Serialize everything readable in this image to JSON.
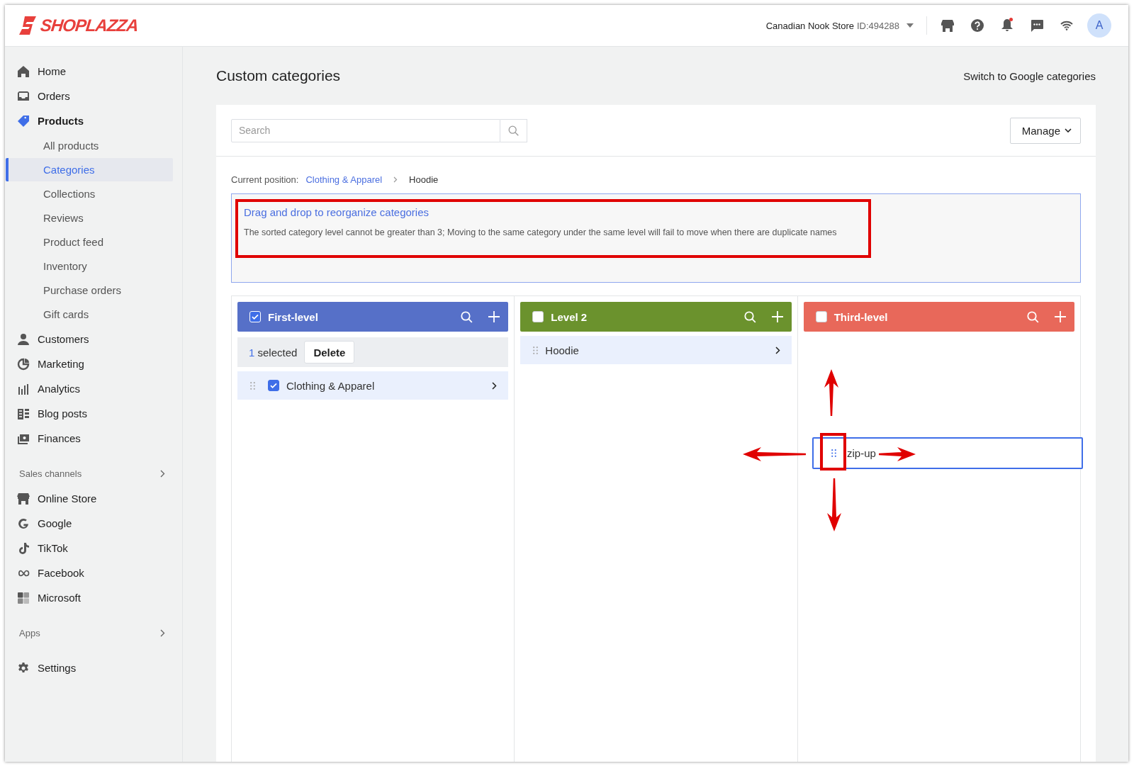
{
  "logo": {
    "text": "SHOPLAZZA"
  },
  "header": {
    "store": "Canadian Nook Store",
    "store_id": "ID:494288",
    "avatar": "A",
    "notification_dot": true
  },
  "sidebar": {
    "groups": [
      {
        "items": [
          {
            "label": "Home",
            "selected": false
          },
          {
            "label": "Orders",
            "selected": false
          },
          {
            "label": "Products",
            "selected": true,
            "children": [
              {
                "label": "All products",
                "selected": false
              },
              {
                "label": "Categories",
                "selected": true
              },
              {
                "label": "Collections",
                "selected": false
              },
              {
                "label": "Reviews",
                "selected": false
              },
              {
                "label": "Product feed",
                "selected": false
              },
              {
                "label": "Inventory",
                "selected": false
              },
              {
                "label": "Purchase orders",
                "selected": false
              },
              {
                "label": "Gift cards",
                "selected": false
              }
            ]
          },
          {
            "label": "Customers",
            "selected": false
          },
          {
            "label": "Marketing",
            "selected": false
          },
          {
            "label": "Analytics",
            "selected": false
          },
          {
            "label": "Blog posts",
            "selected": false
          },
          {
            "label": "Finances",
            "selected": false
          }
        ]
      },
      {
        "heading": "Sales channels",
        "items": [
          {
            "label": "Online Store",
            "selected": false
          },
          {
            "label": "Google",
            "selected": false
          },
          {
            "label": "TikTok",
            "selected": false
          },
          {
            "label": "Facebook",
            "selected": false
          },
          {
            "label": "Microsoft",
            "selected": false
          }
        ]
      },
      {
        "heading": "Apps"
      },
      {
        "items": [
          {
            "label": "Settings",
            "selected": false
          }
        ]
      }
    ]
  },
  "page": {
    "title": "Custom categories",
    "switch_link": "Switch to Google categories"
  },
  "toolbar": {
    "search_placeholder": "Search",
    "manage_button": "Manage"
  },
  "breadcrumb": {
    "label": "Current position:",
    "path": [
      {
        "label": "Clothing & Apparel",
        "link": true
      },
      {
        "label": "Hoodie",
        "link": false
      }
    ]
  },
  "notice": {
    "title": "Drag and drop to reorganize categories",
    "text": "The sorted category level cannot be greater than 3; Moving to the same category under the same level will fail to move when there are duplicate names"
  },
  "columns": [
    {
      "title": "First-level",
      "color": "#5670c8",
      "checked": true,
      "selection": {
        "count": "1",
        "label": "selected",
        "action": "Delete"
      },
      "items": [
        {
          "name": "Clothing & Apparel",
          "checked": true
        }
      ]
    },
    {
      "title": "Level 2",
      "color": "#6b922d",
      "checked": false,
      "items": [
        {
          "name": "Hoodie"
        }
      ]
    },
    {
      "title": "Third-level",
      "color": "#e8685a",
      "checked": false,
      "dragging": {
        "name": "zip-up"
      }
    }
  ]
}
